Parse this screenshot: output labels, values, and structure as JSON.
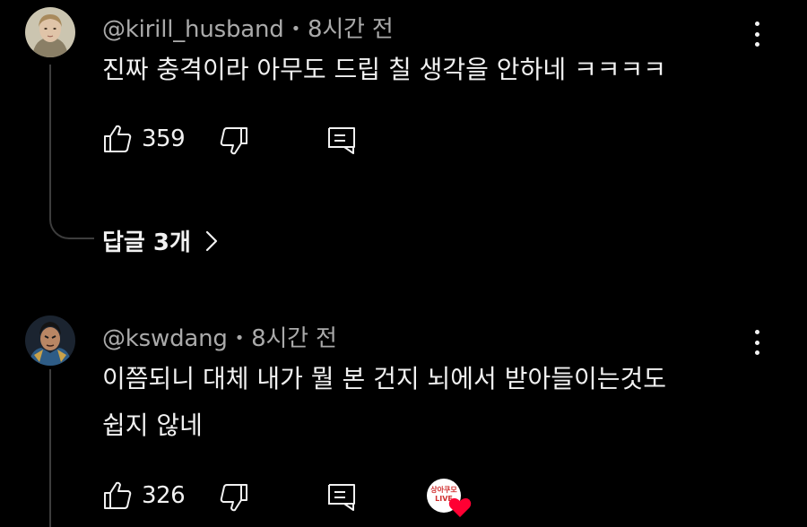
{
  "comments": [
    {
      "handle": "@kirill_husband",
      "separator": "•",
      "time": "8시간 전",
      "text_lines": [
        "진짜 충격이라 아무도 드립 칠 생각을 안하네 ㅋㅋㅋㅋ"
      ],
      "likes": "359",
      "avatar_icon": "portrait-avatar-icon"
    },
    {
      "handle": "@kswdang",
      "separator": "•",
      "time": "8시간 전",
      "text_lines": [
        "이쯤되니 대체 내가 뭘 본 건지 뇌에서 받아들이는것도",
        "쉽지 않네"
      ],
      "likes": "326",
      "avatar_icon": "warrior-avatar-icon",
      "creator_heart": {
        "badge_text": "상아쿠모 LIVE",
        "heart_color": "#ff0033"
      }
    }
  ],
  "replies": {
    "label": "답글 3개",
    "icon": "chevron-right-icon"
  },
  "colors": {
    "background": "#000000",
    "text": "#f1f1f1",
    "meta": "#aaaaaa",
    "thread_line": "#3d3d3d"
  }
}
